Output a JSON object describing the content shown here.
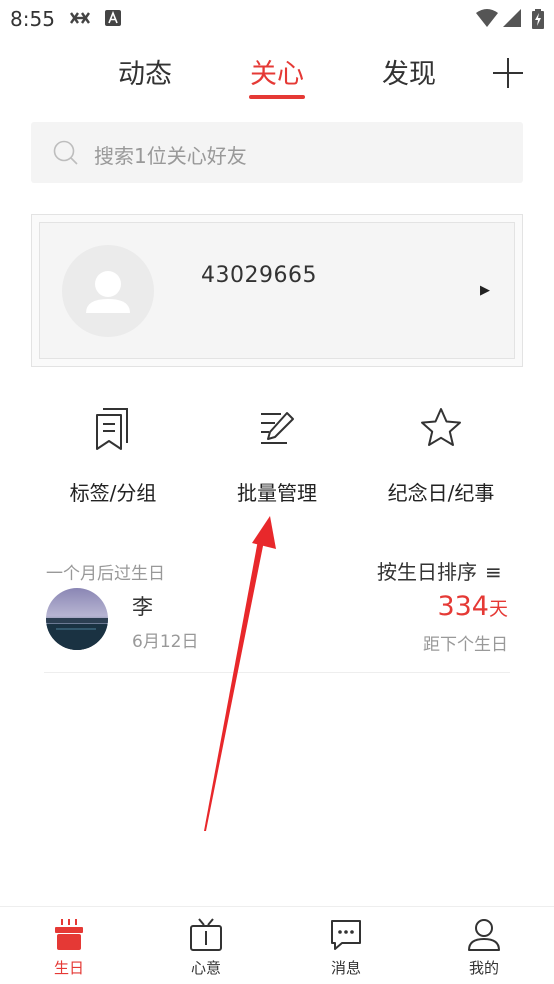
{
  "status_bar": {
    "time": "8:55"
  },
  "top_tabs": [
    {
      "label": "动态",
      "active": false
    },
    {
      "label": "关心",
      "active": true
    },
    {
      "label": "发现",
      "active": false
    }
  ],
  "search": {
    "placeholder": "搜索1位关心好友"
  },
  "profile_card": {
    "id_text": "43029665",
    "arrow": "▶"
  },
  "actions": [
    {
      "label": "标签/分组",
      "icon": "bookmarks-icon"
    },
    {
      "label": "批量管理",
      "icon": "edit-list-icon"
    },
    {
      "label": "纪念日/纪事",
      "icon": "star-icon"
    }
  ],
  "birthday_section": {
    "label": "一个月后过生日",
    "sort_label": "按生日排序",
    "sort_icon": "≡"
  },
  "person": {
    "name": "李",
    "date": "6月12日",
    "days": "334",
    "days_unit": "天",
    "days_caption": "距下个生日"
  },
  "bottom_nav": [
    {
      "label": "生日",
      "icon": "cake-icon",
      "active": true
    },
    {
      "label": "心意",
      "icon": "gift-box-icon",
      "active": false
    },
    {
      "label": "消息",
      "icon": "message-icon",
      "active": false
    },
    {
      "label": "我的",
      "icon": "user-icon",
      "active": false
    }
  ],
  "colors": {
    "accent": "#e53935",
    "annotation_arrow": "#e8282b"
  }
}
